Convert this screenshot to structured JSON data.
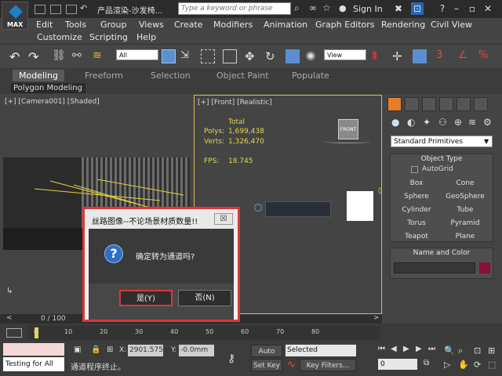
{
  "titlebar": {
    "title": "产品渲染-沙发椅...",
    "search_placeholder": "Type a keyword or phrase",
    "sign_in": "Sign In",
    "logo_text": "MAX"
  },
  "menubar": {
    "items": [
      "Edit",
      "Tools",
      "Group",
      "Views",
      "Create",
      "Modifiers",
      "Animation",
      "Graph Editors",
      "Rendering",
      "Civil View",
      "Customize",
      "Scripting",
      "Help"
    ]
  },
  "toolbar": {
    "filter_select": "All",
    "view_select": "View"
  },
  "ribbon": {
    "tabs": [
      "Modeling",
      "Freeform",
      "Selection",
      "Object Paint",
      "Populate"
    ],
    "subpanel": "Polygon Modeling"
  },
  "viewports": {
    "camera_label": "[+] [Camera001] [Shaded]",
    "front_label": "[+] [Front] [Realistic]",
    "stats": {
      "total_label": "Total",
      "polys_label": "Polys:",
      "polys_value": "1,699,438",
      "verts_label": "Verts:",
      "verts_value": "1,326,470",
      "fps_label": "FPS:",
      "fps_value": "18.745"
    },
    "front_box_label": "FRONT"
  },
  "command_panel": {
    "dropdown": "Standard Primitives",
    "object_type_title": "Object Type",
    "autogrid": "AutoGrid",
    "buttons": [
      "Box",
      "Cone",
      "Sphere",
      "GeoSphere",
      "Cylinder",
      "Tube",
      "Torus",
      "Pyramid",
      "Teapot",
      "Plane"
    ],
    "name_color_title": "Name and Color",
    "color": "#8a0f3a"
  },
  "timeline": {
    "frame_display": "0 / 100",
    "ticks": [
      "0",
      "10",
      "20",
      "30",
      "40",
      "50",
      "60",
      "70",
      "80"
    ]
  },
  "status": {
    "maxscript_text": "Testing for All",
    "message": "通道程序终止。",
    "x_label": "X:",
    "x_value": "2901.575m",
    "y_label": "Y:",
    "y_value": "-0.0mm",
    "auto_key": "Auto Key",
    "set_key": "Set Key",
    "selected_select": "Selected",
    "key_filters": "Key Filters...",
    "frame_value": "0"
  },
  "dialog": {
    "title": "丝路图像--不论场景材质数量!!",
    "close": "☒",
    "message": "确定转为通道吗?",
    "yes": "是(Y)",
    "no": "否(N)"
  },
  "colors": {
    "accent_red": "#d9373b",
    "stat_yellow": "#e3d94a",
    "active_border": "#d6c24a"
  }
}
